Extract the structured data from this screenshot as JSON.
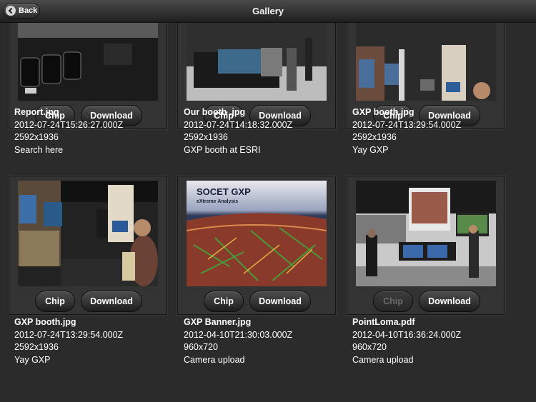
{
  "navbar": {
    "title": "Gallery",
    "back_label": "Back"
  },
  "buttons": {
    "chip_label": "Chip",
    "download_label": "Download"
  },
  "items": [
    {
      "name": "Report.jpg",
      "timestamp": "2012-07-24T15:26:27.000Z",
      "dimensions": "2592x1936",
      "caption": "Search here",
      "chip_enabled": true
    },
    {
      "name": "Our booth .jpg",
      "timestamp": "2012-07-24T14:18:32.000Z",
      "dimensions": "2592x1936",
      "caption": "GXP booth at ESRI",
      "chip_enabled": true
    },
    {
      "name": "GXP booth.jpg",
      "timestamp": "2012-07-24T13:29:54.000Z",
      "dimensions": "2592x1936",
      "caption": "Yay GXP",
      "chip_enabled": true
    },
    {
      "name": "GXP booth.jpg",
      "timestamp": "2012-07-24T13:29:54.000Z",
      "dimensions": "2592x1936",
      "caption": "Yay GXP",
      "chip_enabled": true
    },
    {
      "name": "GXP Banner.jpg",
      "timestamp": "2012-04-10T21:30:03.000Z",
      "dimensions": "960x720",
      "caption": "Camera upload",
      "chip_enabled": true
    },
    {
      "name": "PointLoma.pdf",
      "timestamp": "2012-04-10T16:36:24.000Z",
      "dimensions": "960x720",
      "caption": "Camera upload",
      "chip_enabled": false
    }
  ],
  "thumbnail_text": {
    "banner_title": "SOCET GXP",
    "banner_subtitle": "eXtreme Analysis"
  },
  "colors": {
    "background": "#2b2b2b",
    "card": "#333333",
    "navbar": "#2a2a2a"
  }
}
